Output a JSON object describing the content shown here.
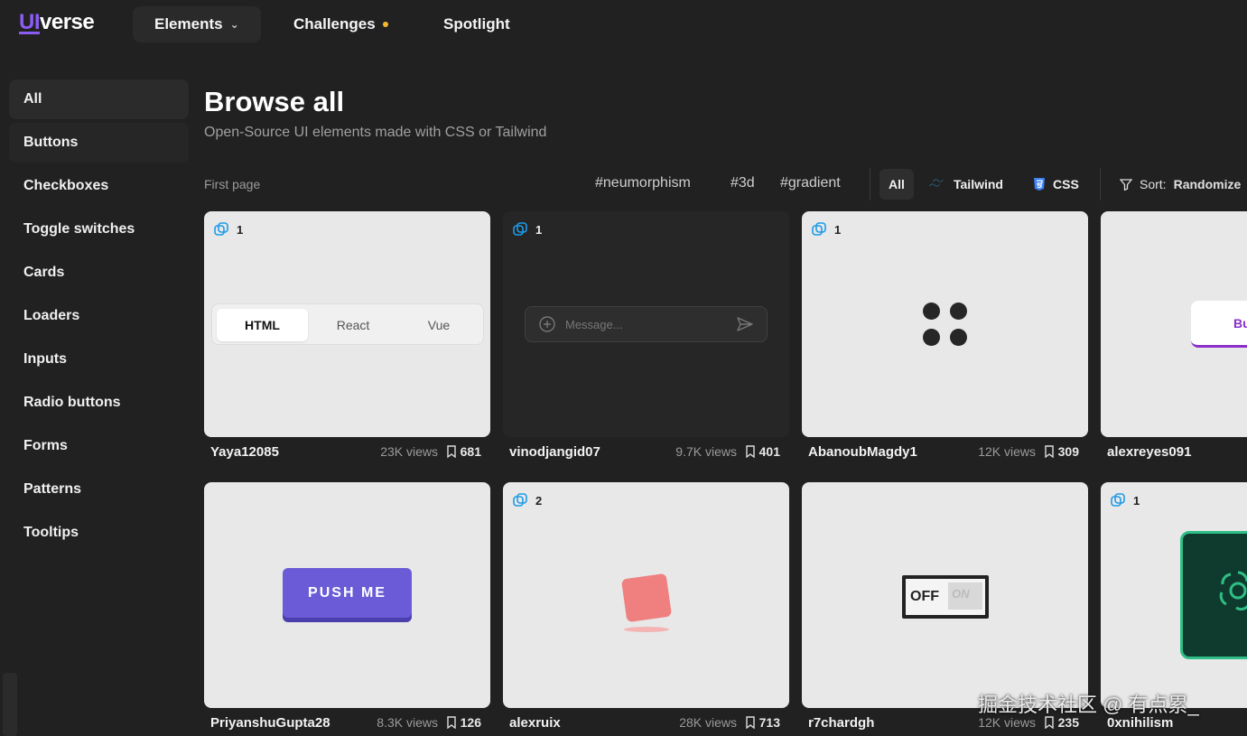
{
  "header": {
    "logo_ui": "UI",
    "logo_rest": "verse",
    "nav": [
      {
        "label": "Elements"
      },
      {
        "label": "Challenges"
      },
      {
        "label": "Spotlight"
      }
    ]
  },
  "sidebar": {
    "items": [
      {
        "label": "All"
      },
      {
        "label": "Buttons"
      },
      {
        "label": "Checkboxes"
      },
      {
        "label": "Toggle switches"
      },
      {
        "label": "Cards"
      },
      {
        "label": "Loaders"
      },
      {
        "label": "Inputs"
      },
      {
        "label": "Radio buttons"
      },
      {
        "label": "Forms"
      },
      {
        "label": "Patterns"
      },
      {
        "label": "Tooltips"
      }
    ]
  },
  "main": {
    "title": "Browse all",
    "subtitle": "Open-Source UI elements made with CSS or Tailwind",
    "first_page": "First page",
    "tags": [
      "#neumorphism",
      "#3d",
      "#gradient"
    ],
    "filters": {
      "all": "All",
      "tailwind": "Tailwind",
      "css": "CSS"
    },
    "sort_label": "Sort:",
    "sort_value": "Randomize"
  },
  "cards": [
    {
      "count": "1",
      "author": "Yaya12085",
      "views": "23K views",
      "saves": "681",
      "preview": {
        "tabs": [
          "HTML",
          "React",
          "Vue"
        ]
      }
    },
    {
      "count": "1",
      "author": "vinodjangid07",
      "views": "9.7K views",
      "saves": "401",
      "preview": {
        "placeholder": "Message..."
      }
    },
    {
      "count": "1",
      "author": "AbanoubMagdy1",
      "views": "12K views",
      "saves": "309"
    },
    {
      "count": "",
      "author": "alexreyes091",
      "views": "",
      "saves": "",
      "preview": {
        "label": "Butt"
      }
    },
    {
      "count": "",
      "author": "PriyanshuGupta28",
      "views": "8.3K views",
      "saves": "126",
      "preview": {
        "label": "PUSH ME"
      }
    },
    {
      "count": "2",
      "author": "alexruix",
      "views": "28K views",
      "saves": "713"
    },
    {
      "count": "",
      "author": "r7chardgh",
      "views": "12K views",
      "saves": "235",
      "preview": {
        "off": "OFF",
        "on": "ON"
      }
    },
    {
      "count": "1",
      "author": "0xnihilism",
      "views": "",
      "saves": ""
    }
  ],
  "watermark": "掘金技术社区 @ 有点累_",
  "colors": {
    "accent": "#8b5cf6",
    "background": "#212121",
    "challenge_dot": "#f5b82e",
    "tailwind": "#38bdf8",
    "css": "#3b82f6"
  }
}
